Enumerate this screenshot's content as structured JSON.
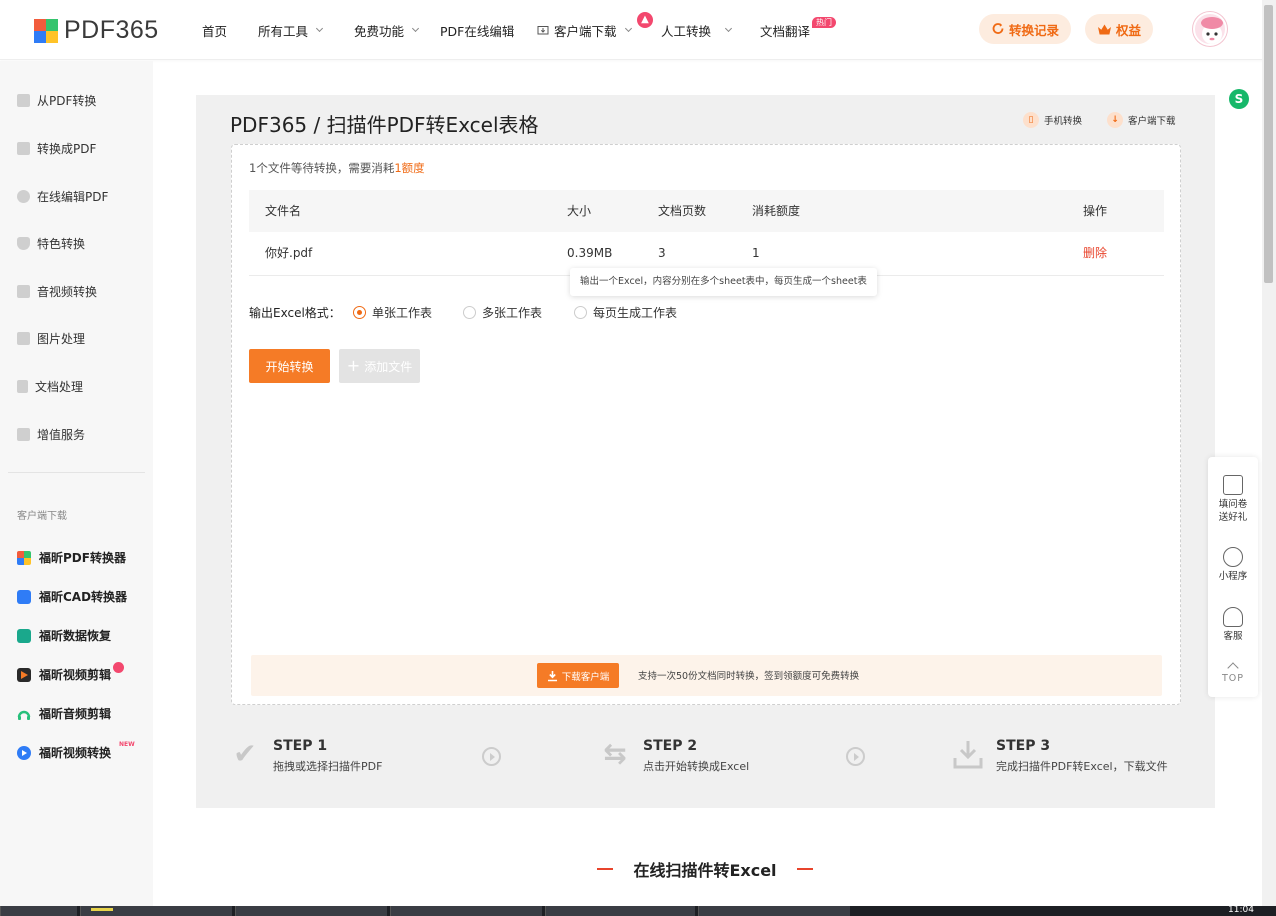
{
  "header": {
    "logo_text": "PDF365",
    "nav": [
      {
        "label": "首页",
        "has_caret": false
      },
      {
        "label": "所有工具",
        "has_caret": true
      },
      {
        "label": "免费功能",
        "has_caret": true
      },
      {
        "label": "PDF在线编辑",
        "has_caret": false
      },
      {
        "label": "客户端下载",
        "has_caret": true
      },
      {
        "label": "人工转换",
        "has_caret": true
      },
      {
        "label": "文档翻译",
        "has_caret": false
      }
    ],
    "hot_badge": "热门",
    "history_label": "转换记录",
    "rights_label": "权益",
    "accent_color": "#f06a14"
  },
  "sidebar": {
    "items": [
      {
        "label": "从PDF转换",
        "icon": "from-pdf-icon"
      },
      {
        "label": "转换成PDF",
        "icon": "to-pdf-icon"
      },
      {
        "label": "在线编辑PDF",
        "icon": "edit-pdf-icon"
      },
      {
        "label": "特色转换",
        "icon": "special-icon"
      },
      {
        "label": "音视频转换",
        "icon": "media-icon"
      },
      {
        "label": "图片处理",
        "icon": "image-icon"
      },
      {
        "label": "文档处理",
        "icon": "document-icon"
      },
      {
        "label": "增值服务",
        "icon": "service-icon"
      }
    ],
    "client_caption": "客户端下载",
    "apps": [
      {
        "label": "福昕PDF转换器",
        "color": "#f25c3c"
      },
      {
        "label": "福昕CAD转换器",
        "color": "#2f7cf6"
      },
      {
        "label": "福昕数据恢复",
        "color": "#1aa88c"
      },
      {
        "label": "福昕视频剪辑",
        "color": "#2a2a2a"
      },
      {
        "label": "福昕音频剪辑",
        "color": "#27c07b"
      },
      {
        "label": "福昕视频转换",
        "color": "#2f7cf6"
      }
    ],
    "new_badge": "NEW"
  },
  "main": {
    "title": "PDF365 / 扫描件PDF转Excel表格",
    "mobile_link": "手机转换",
    "client_link": "客户端下载",
    "notice_prefix": "1个文件等待转换，需要消耗",
    "notice_highlight": "1额度",
    "table": {
      "headers": [
        "文件名",
        "大小",
        "文档页数",
        "消耗额度",
        "操作"
      ],
      "row": {
        "name": "你好.pdf",
        "size": "0.39MB",
        "pages": "3",
        "cost": "1",
        "action": "删除"
      }
    },
    "tooltip": "输出一个Excel，内容分别在多个sheet表中，每页生成一个sheet表",
    "format_label": "输出Excel格式：",
    "formats": [
      {
        "label": "单张工作表",
        "selected": true
      },
      {
        "label": "多张工作表",
        "selected": false
      },
      {
        "label": "每页生成工作表",
        "selected": false
      }
    ],
    "start_button": "开始转换",
    "add_button": "添加文件",
    "download_button": "下载客户端",
    "download_text": "支持一次50份文档同时转换，签到领额度可免费转换"
  },
  "steps": [
    {
      "title": "STEP 1",
      "desc": "拖拽或选择扫描件PDF"
    },
    {
      "title": "STEP 2",
      "desc": "点击开始转换成Excel"
    },
    {
      "title": "STEP 3",
      "desc": "完成扫描件PDF转Excel，下载文件"
    }
  ],
  "section_heading": "在线扫描件转Excel",
  "float": {
    "survey": "填问卷送好礼",
    "mini_program": "小程序",
    "service": "客服",
    "top": "TOP"
  },
  "taskbar": {
    "clock": "11:04"
  }
}
